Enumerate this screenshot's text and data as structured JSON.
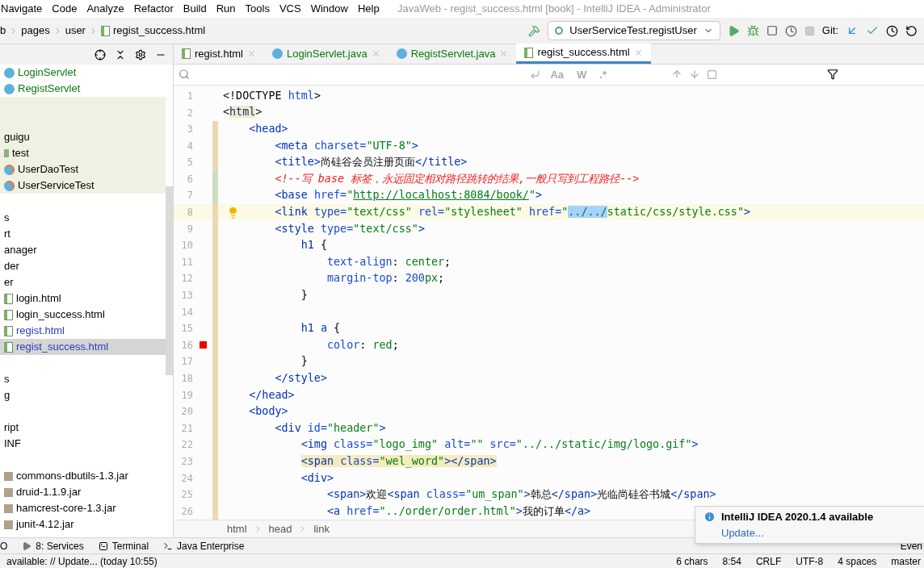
{
  "window": {
    "title": "JavaWeb - regist_success.html [book] - IntelliJ IDEA - Administrator"
  },
  "menu": [
    "Navigate",
    "Code",
    "Analyze",
    "Refactor",
    "Build",
    "Run",
    "Tools",
    "VCS",
    "Window",
    "Help"
  ],
  "nav_path": [
    "b",
    "pages",
    "user",
    "regist_success.html"
  ],
  "run_config": "UserServiceTest.registUser",
  "git_label": "Git:",
  "tree": [
    {
      "kind": "class",
      "text": "LoginServlet",
      "color": "#0b7a0b",
      "selected": false
    },
    {
      "kind": "class",
      "text": "RegistServlet",
      "color": "#0b7a0b",
      "selected": false
    },
    {
      "kind": "blank",
      "test_root": true
    },
    {
      "kind": "blank",
      "test_root": true
    },
    {
      "kind": "plain",
      "text": "guigu",
      "selected": false,
      "test_root": true
    },
    {
      "kind": "folder",
      "text": "test",
      "selected": false,
      "test_root": true
    },
    {
      "kind": "test",
      "text": "UserDaoTest",
      "selected": false,
      "test_root": true
    },
    {
      "kind": "test",
      "text": "UserServiceTest",
      "selected": false,
      "test_root": true
    },
    {
      "kind": "blank"
    },
    {
      "kind": "plain",
      "text": "s",
      "selected": false
    },
    {
      "kind": "plain",
      "text": "rt",
      "selected": false
    },
    {
      "kind": "plain",
      "text": "anager",
      "selected": false
    },
    {
      "kind": "plain",
      "text": "der",
      "selected": false
    },
    {
      "kind": "plain",
      "text": "er",
      "selected": false
    },
    {
      "kind": "html",
      "text": "login.html",
      "selected": false
    },
    {
      "kind": "html",
      "text": "login_success.html",
      "selected": false
    },
    {
      "kind": "html",
      "text": "regist.html",
      "color": "#2a3dbd",
      "selected": false
    },
    {
      "kind": "html",
      "text": "regist_success.html",
      "color": "#2a3dbd",
      "selected": true
    },
    {
      "kind": "blank"
    },
    {
      "kind": "plain",
      "text": "s",
      "selected": false
    },
    {
      "kind": "plain",
      "text": "g",
      "selected": false
    },
    {
      "kind": "blank"
    },
    {
      "kind": "plain",
      "text": "ript",
      "selected": false
    },
    {
      "kind": "plain",
      "text": "INF",
      "selected": false
    },
    {
      "kind": "blank"
    },
    {
      "kind": "jar",
      "text": "commons-dbutils-1.3.jar",
      "selected": false
    },
    {
      "kind": "jar",
      "text": "druid-1.1.9.jar",
      "selected": false
    },
    {
      "kind": "jar",
      "text": "hamcrest-core-1.3.jar",
      "selected": false
    },
    {
      "kind": "jar",
      "text": "junit-4.12.jar",
      "selected": false
    }
  ],
  "tabs": [
    {
      "kind": "html",
      "label": "regist.html",
      "selected": false
    },
    {
      "kind": "class",
      "label": "LoginServlet.java",
      "selected": false
    },
    {
      "kind": "class",
      "label": "RegistServlet.java",
      "selected": false
    },
    {
      "kind": "html",
      "label": "regist_success.html",
      "selected": true
    }
  ],
  "find_toggles": [
    "Aa",
    "W",
    ".*"
  ],
  "code": [
    {
      "number": "1",
      "tokens": [
        {
          "kind": "text",
          "text": "<!DOCTYPE "
        },
        {
          "kind": "attr",
          "text": "html"
        },
        {
          "kind": "text",
          "text": ">"
        }
      ]
    },
    {
      "number": "2",
      "tokens": [
        {
          "kind": "text",
          "text": "<"
        },
        {
          "kind": "tag_match",
          "text": "html"
        },
        {
          "kind": "text",
          "text": ">"
        }
      ]
    },
    {
      "number": "3",
      "modified": true,
      "tokens": [
        {
          "kind": "tag",
          "text": "    <head>"
        }
      ]
    },
    {
      "number": "4",
      "modified": true,
      "tokens": [
        {
          "kind": "tag",
          "text": "        <meta "
        },
        {
          "kind": "attr",
          "text": "charset="
        },
        {
          "kind": "value",
          "text": "\"UTF-8\""
        },
        {
          "kind": "tag",
          "text": ">"
        }
      ]
    },
    {
      "number": "5",
      "modified": true,
      "tokens": [
        {
          "kind": "tag",
          "text": "        <title>"
        },
        {
          "kind": "text",
          "text": "尚硅谷会员注册页面"
        },
        {
          "kind": "tag",
          "text": "</title>"
        }
      ]
    },
    {
      "number": "6",
      "added": true,
      "tokens": [
        {
          "kind": "comment",
          "text": "        <!--写 base 标签，永远固定相对路径跳转的结果,一般只写到工程路径-->"
        }
      ]
    },
    {
      "number": "7",
      "added": true,
      "tokens": [
        {
          "kind": "tag",
          "text": "        <base "
        },
        {
          "kind": "attr",
          "text": "href="
        },
        {
          "kind": "value",
          "text": "\""
        },
        {
          "kind": "url",
          "text": "http://localhost:8084/book/"
        },
        {
          "kind": "value",
          "text": "\""
        },
        {
          "kind": "tag",
          "text": ">"
        }
      ]
    },
    {
      "number": "8",
      "modified": true,
      "current": true,
      "bulb": true,
      "tokens": [
        {
          "kind": "tag",
          "text": "        <link "
        },
        {
          "kind": "attr",
          "text": "type="
        },
        {
          "kind": "value",
          "text": "\"text/css\" "
        },
        {
          "kind": "attr",
          "text": "rel="
        },
        {
          "kind": "value",
          "text": "\"stylesheet\" "
        },
        {
          "kind": "attr",
          "text": "href="
        },
        {
          "kind": "value",
          "text": "\""
        },
        {
          "kind": "value_sel",
          "text": "../../"
        },
        {
          "kind": "value",
          "text": "static/css/style.css\""
        },
        {
          "kind": "tag",
          "text": ">"
        }
      ]
    },
    {
      "number": "9",
      "modified": true,
      "tokens": [
        {
          "kind": "tag",
          "text": "        <style "
        },
        {
          "kind": "attr",
          "text": "type="
        },
        {
          "kind": "value",
          "text": "\"text/css\""
        },
        {
          "kind": "tag",
          "text": ">"
        }
      ]
    },
    {
      "number": "10",
      "modified": true,
      "tokens": [
        {
          "kind": "tag",
          "text": "            h1 "
        },
        {
          "kind": "text",
          "text": "{"
        }
      ]
    },
    {
      "number": "11",
      "modified": true,
      "tokens": [
        {
          "kind": "attr",
          "text": "                text-align"
        },
        {
          "kind": "text",
          "text": ": "
        },
        {
          "kind": "value",
          "text": "center"
        },
        {
          "kind": "text",
          "text": ";"
        }
      ]
    },
    {
      "number": "12",
      "modified": true,
      "tokens": [
        {
          "kind": "attr",
          "text": "                margin-top"
        },
        {
          "kind": "text",
          "text": ": "
        },
        {
          "kind": "attr",
          "text": "200"
        },
        {
          "kind": "value",
          "text": "px"
        },
        {
          "kind": "text",
          "text": ";"
        }
      ]
    },
    {
      "number": "13",
      "modified": true,
      "tokens": [
        {
          "kind": "text",
          "text": "            }"
        }
      ]
    },
    {
      "number": "14",
      "modified": true
    },
    {
      "number": "15",
      "modified": true,
      "tokens": [
        {
          "kind": "tag",
          "text": "            h1 a "
        },
        {
          "kind": "text",
          "text": "{"
        }
      ]
    },
    {
      "number": "16",
      "modified": true,
      "breakpoint": true,
      "tokens": [
        {
          "kind": "attr",
          "text": "                color"
        },
        {
          "kind": "text",
          "text": ": "
        },
        {
          "kind": "value",
          "text": "red"
        },
        {
          "kind": "text",
          "text": ";"
        }
      ]
    },
    {
      "number": "17",
      "modified": true,
      "tokens": [
        {
          "kind": "text",
          "text": "            }"
        }
      ]
    },
    {
      "number": "18",
      "modified": true,
      "tokens": [
        {
          "kind": "tag",
          "text": "        </style>"
        }
      ]
    },
    {
      "number": "19",
      "modified": true,
      "tokens": [
        {
          "kind": "tag",
          "text": "    </head>"
        }
      ]
    },
    {
      "number": "20",
      "modified": true,
      "tokens": [
        {
          "kind": "tag",
          "text": "    <body>"
        }
      ]
    },
    {
      "number": "21",
      "modified": true,
      "tokens": [
        {
          "kind": "tag",
          "text": "        <div "
        },
        {
          "kind": "attr",
          "text": "id="
        },
        {
          "kind": "value",
          "text": "\"header\""
        },
        {
          "kind": "tag",
          "text": ">"
        }
      ]
    },
    {
      "number": "22",
      "modified": true,
      "tokens": [
        {
          "kind": "tag",
          "text": "            <img "
        },
        {
          "kind": "attr",
          "text": "class="
        },
        {
          "kind": "value",
          "text": "\"logo_img\" "
        },
        {
          "kind": "attr",
          "text": "alt="
        },
        {
          "kind": "value",
          "text": "\"\" "
        },
        {
          "kind": "attr",
          "text": "src="
        },
        {
          "kind": "value",
          "text": "\"../../static/img/logo.gif\""
        },
        {
          "kind": "tag",
          "text": ">"
        }
      ]
    },
    {
      "number": "23",
      "modified": true,
      "tokens": [
        {
          "kind": "tag_match",
          "text": "            <span "
        },
        {
          "kind": "attr_match",
          "text": "class="
        },
        {
          "kind": "value_match",
          "text": "\"wel_word\""
        },
        {
          "kind": "tag_match",
          "text": "></span>"
        }
      ]
    },
    {
      "number": "24",
      "modified": true,
      "tokens": [
        {
          "kind": "tag",
          "text": "            <div>"
        }
      ]
    },
    {
      "number": "25",
      "modified": true,
      "tokens": [
        {
          "kind": "tag",
          "text": "                <span>"
        },
        {
          "kind": "text",
          "text": "欢迎"
        },
        {
          "kind": "tag",
          "text": "<span "
        },
        {
          "kind": "attr",
          "text": "class="
        },
        {
          "kind": "value",
          "text": "\"um_span\""
        },
        {
          "kind": "tag",
          "text": ">"
        },
        {
          "kind": "text",
          "text": "韩总"
        },
        {
          "kind": "tag",
          "text": "</span>"
        },
        {
          "kind": "text",
          "text": "光临尚硅谷书城"
        },
        {
          "kind": "tag",
          "text": "</span>"
        }
      ]
    },
    {
      "number": "26",
      "modified": true,
      "tokens": [
        {
          "kind": "tag",
          "text": "                <a "
        },
        {
          "kind": "attr",
          "text": "href="
        },
        {
          "kind": "value",
          "text": "\"../order/order.html\""
        },
        {
          "kind": "tag",
          "text": ">"
        },
        {
          "kind": "text",
          "text": "我的订单"
        },
        {
          "kind": "tag",
          "text": "</a>"
        }
      ]
    }
  ],
  "breadcrumb": [
    "html",
    "head",
    "link"
  ],
  "tool_windows": [
    {
      "kind": "plain",
      "label": "O"
    },
    {
      "kind": "services",
      "label": "8: Services"
    },
    {
      "kind": "terminal",
      "label": "Terminal"
    },
    {
      "kind": "enterprise",
      "label": "Java Enterprise"
    }
  ],
  "event_log": "Even",
  "notification": {
    "title": "IntelliJ IDEA 2020.1.4 available",
    "link": "Update..."
  },
  "status_bar": {
    "message": "available: // Update... (today 10:55)",
    "items": [
      "6 chars",
      "8:54",
      "CRLF",
      "UTF-8",
      "4 spaces",
      "master"
    ]
  }
}
